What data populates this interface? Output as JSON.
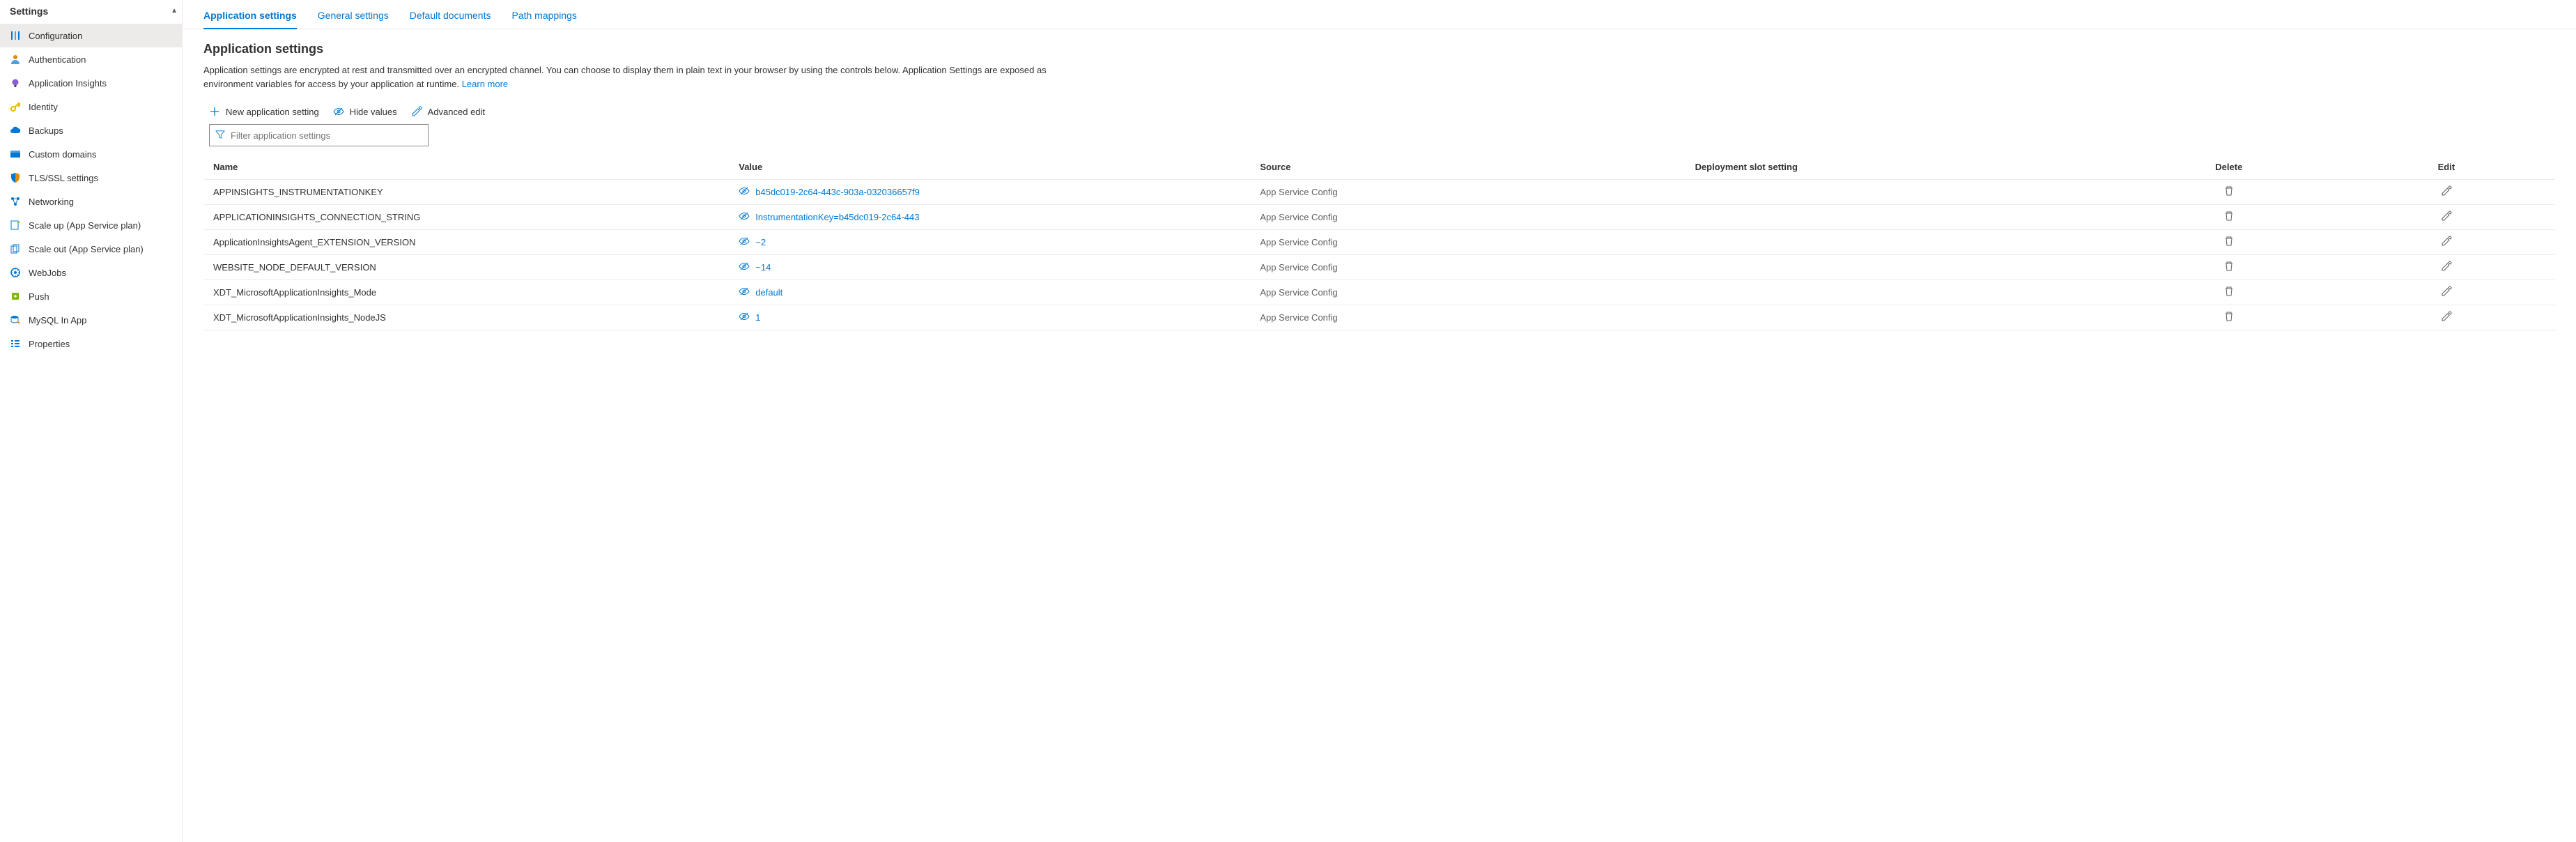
{
  "sidebar": {
    "header": "Settings",
    "items": [
      {
        "label": "Configuration",
        "key": "sidebar-item-configuration",
        "iconKey": "sliders-icon",
        "active": true
      },
      {
        "label": "Authentication",
        "key": "sidebar-item-authentication",
        "iconKey": "person-icon",
        "active": false
      },
      {
        "label": "Application Insights",
        "key": "sidebar-item-appinsights",
        "iconKey": "bulb-icon",
        "active": false
      },
      {
        "label": "Identity",
        "key": "sidebar-item-identity",
        "iconKey": "key-icon",
        "active": false
      },
      {
        "label": "Backups",
        "key": "sidebar-item-backups",
        "iconKey": "cloud-icon",
        "active": false
      },
      {
        "label": "Custom domains",
        "key": "sidebar-item-customdomains",
        "iconKey": "domain-icon",
        "active": false
      },
      {
        "label": "TLS/SSL settings",
        "key": "sidebar-item-tls",
        "iconKey": "shield-icon",
        "active": false
      },
      {
        "label": "Networking",
        "key": "sidebar-item-networking",
        "iconKey": "network-icon",
        "active": false
      },
      {
        "label": "Scale up (App Service plan)",
        "key": "sidebar-item-scaleup",
        "iconKey": "scaleup-icon",
        "active": false
      },
      {
        "label": "Scale out (App Service plan)",
        "key": "sidebar-item-scaleout",
        "iconKey": "scaleout-icon",
        "active": false
      },
      {
        "label": "WebJobs",
        "key": "sidebar-item-webjobs",
        "iconKey": "webjobs-icon",
        "active": false
      },
      {
        "label": "Push",
        "key": "sidebar-item-push",
        "iconKey": "push-icon",
        "active": false
      },
      {
        "label": "MySQL In App",
        "key": "sidebar-item-mysql",
        "iconKey": "mysql-icon",
        "active": false
      },
      {
        "label": "Properties",
        "key": "sidebar-item-properties",
        "iconKey": "properties-icon",
        "active": false
      }
    ]
  },
  "tabs": [
    {
      "label": "Application settings",
      "key": "tab-app-settings",
      "active": true
    },
    {
      "label": "General settings",
      "key": "tab-general-settings",
      "active": false
    },
    {
      "label": "Default documents",
      "key": "tab-default-documents",
      "active": false
    },
    {
      "label": "Path mappings",
      "key": "tab-path-mappings",
      "active": false
    }
  ],
  "section": {
    "title": "Application settings",
    "desc_pre": "Application settings are encrypted at rest and transmitted over an encrypted channel. You can choose to display them in plain text in your browser by using the controls below. Application Settings are exposed as environment variables for access by your application at runtime. ",
    "learn_more": "Learn more"
  },
  "toolbar": {
    "new_label": "New application setting",
    "hide_label": "Hide values",
    "advanced_label": "Advanced edit"
  },
  "filter": {
    "placeholder": "Filter application settings"
  },
  "table": {
    "headers": {
      "name": "Name",
      "value": "Value",
      "source": "Source",
      "slot": "Deployment slot setting",
      "delete": "Delete",
      "edit": "Edit"
    },
    "rows": [
      {
        "name": "APPINSIGHTS_INSTRUMENTATIONKEY",
        "value": "b45dc019-2c64-443c-903a-032036657f9",
        "source": "App Service Config",
        "slot": ""
      },
      {
        "name": "APPLICATIONINSIGHTS_CONNECTION_STRING",
        "value": "InstrumentationKey=b45dc019-2c64-443",
        "source": "App Service Config",
        "slot": ""
      },
      {
        "name": "ApplicationInsightsAgent_EXTENSION_VERSION",
        "value": "~2",
        "source": "App Service Config",
        "slot": ""
      },
      {
        "name": "WEBSITE_NODE_DEFAULT_VERSION",
        "value": "~14",
        "source": "App Service Config",
        "slot": ""
      },
      {
        "name": "XDT_MicrosoftApplicationInsights_Mode",
        "value": "default",
        "source": "App Service Config",
        "slot": ""
      },
      {
        "name": "XDT_MicrosoftApplicationInsights_NodeJS",
        "value": "1",
        "source": "App Service Config",
        "slot": ""
      }
    ]
  }
}
